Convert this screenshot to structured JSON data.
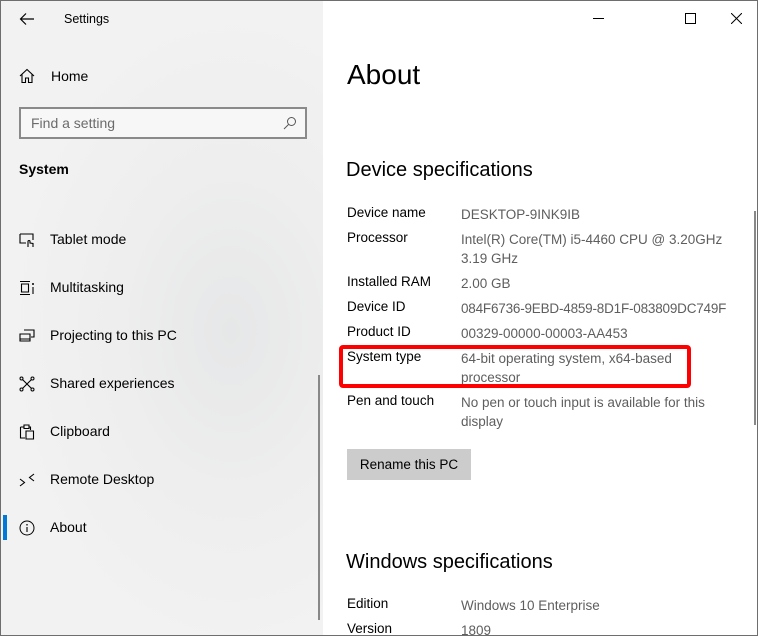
{
  "window": {
    "title": "Settings",
    "controls": {
      "minimize": "minimize",
      "maximize": "maximize",
      "close": "close"
    }
  },
  "sidebar": {
    "home_label": "Home",
    "search": {
      "placeholder": "Find a setting",
      "value": ""
    },
    "section_label": "System",
    "items": [
      {
        "label": "Tablet mode",
        "icon": "tablet-mode-icon",
        "selected": false
      },
      {
        "label": "Multitasking",
        "icon": "multitasking-icon",
        "selected": false
      },
      {
        "label": "Projecting to this PC",
        "icon": "projecting-icon",
        "selected": false
      },
      {
        "label": "Shared experiences",
        "icon": "shared-experiences-icon",
        "selected": false
      },
      {
        "label": "Clipboard",
        "icon": "clipboard-icon",
        "selected": false
      },
      {
        "label": "Remote Desktop",
        "icon": "remote-desktop-icon",
        "selected": false
      },
      {
        "label": "About",
        "icon": "info-icon",
        "selected": true
      }
    ],
    "accent_color": "#0078d7"
  },
  "main": {
    "title": "About",
    "device_specs": {
      "heading": "Device specifications",
      "rows": [
        {
          "key": "Device name",
          "value": "DESKTOP-9INK9IB"
        },
        {
          "key": "Processor",
          "value": "Intel(R) Core(TM) i5-4460  CPU @ 3.20GHz 3.19 GHz"
        },
        {
          "key": "Installed RAM",
          "value": "2.00 GB"
        },
        {
          "key": "Device ID",
          "value": "084F6736-9EBD-4859-8D1F-083809DC749F"
        },
        {
          "key": "Product ID",
          "value": "00329-00000-00003-AA453"
        },
        {
          "key": "System type",
          "value": "64-bit operating system, x64-based processor"
        },
        {
          "key": "Pen and touch",
          "value": "No pen or touch input is available for this display"
        }
      ],
      "highlighted_row": "System type",
      "highlight_color": "#ff0000"
    },
    "rename_button": "Rename this PC",
    "windows_specs": {
      "heading": "Windows specifications",
      "rows": [
        {
          "key": "Edition",
          "value": "Windows 10 Enterprise"
        },
        {
          "key": "Version",
          "value": "1809"
        }
      ]
    }
  }
}
